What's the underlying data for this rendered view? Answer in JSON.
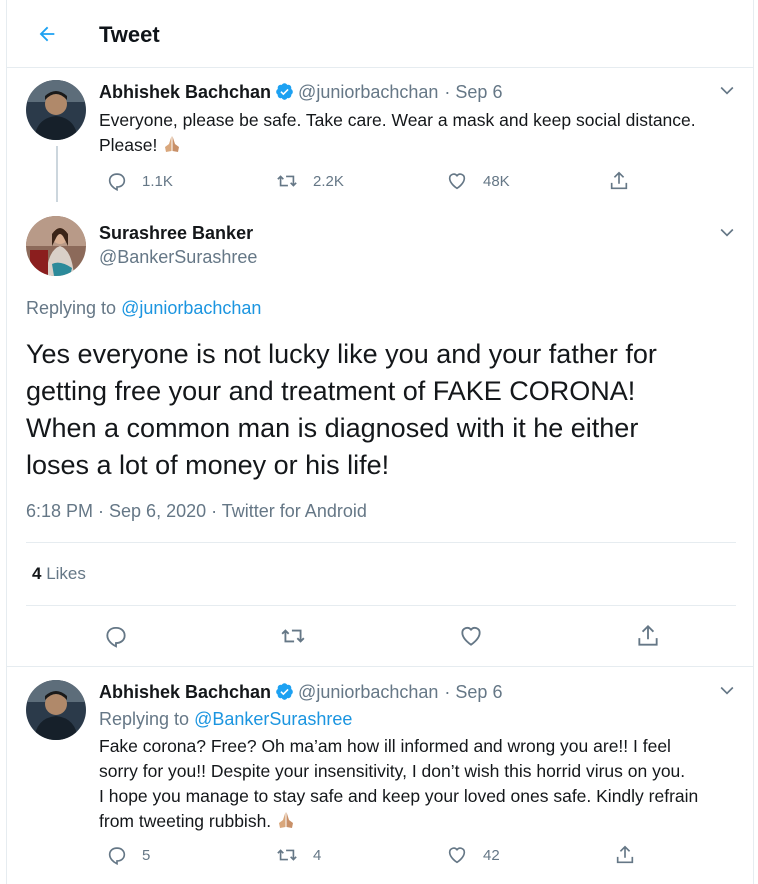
{
  "header": {
    "title": "Tweet"
  },
  "tweet1": {
    "name": "Abhishek Bachchan",
    "handle": "@juniorbachchan",
    "date": "· Sep 6",
    "text_line1": "Everyone, please be safe. Take care. Wear a mask and keep social distance.",
    "text_line2": "Please!",
    "replies": "1.1K",
    "retweets": "2.2K",
    "likes": "48K"
  },
  "main": {
    "name": "Surashree Banker",
    "handle": "@BankerSurashree",
    "replying_prefix": "Replying to",
    "replying_handle": "@juniorbachchan",
    "text_lines": [
      "Yes everyone is not lucky like you and your father for",
      "getting free your and treatment of FAKE CORONA!",
      "When a common man is diagnosed with it he either",
      "loses a lot of money or his life!"
    ],
    "timestamp": "6:18 PM · Sep 6, 2020 · Twitter for Android",
    "likes_count": "4",
    "likes_label": "Likes"
  },
  "reply": {
    "name": "Abhishek Bachchan",
    "handle": "@juniorbachchan",
    "date": "· Sep 6",
    "replying_prefix": "Replying to",
    "replying_handle": "@BankerSurashree",
    "text_lines": [
      "Fake corona? Free? Oh ma’am how ill informed and wrong you are!! I feel",
      "sorry for you!! Despite your insensitivity, I don’t wish this horrid virus on you.",
      "I hope you manage to stay safe and keep your loved ones safe. Kindly refrain",
      "from tweeting rubbish."
    ],
    "replies": "5",
    "retweets": "4",
    "likes": "42"
  },
  "colors": {
    "accent": "#1da1f2",
    "link": "#1b95e0",
    "muted": "#657786",
    "border": "#e6ecf0"
  },
  "icons": [
    "back-arrow-icon",
    "verified-badge-icon",
    "chevron-down-icon",
    "reply-icon",
    "retweet-icon",
    "like-icon",
    "share-icon",
    "folded-hands-emoji"
  ]
}
